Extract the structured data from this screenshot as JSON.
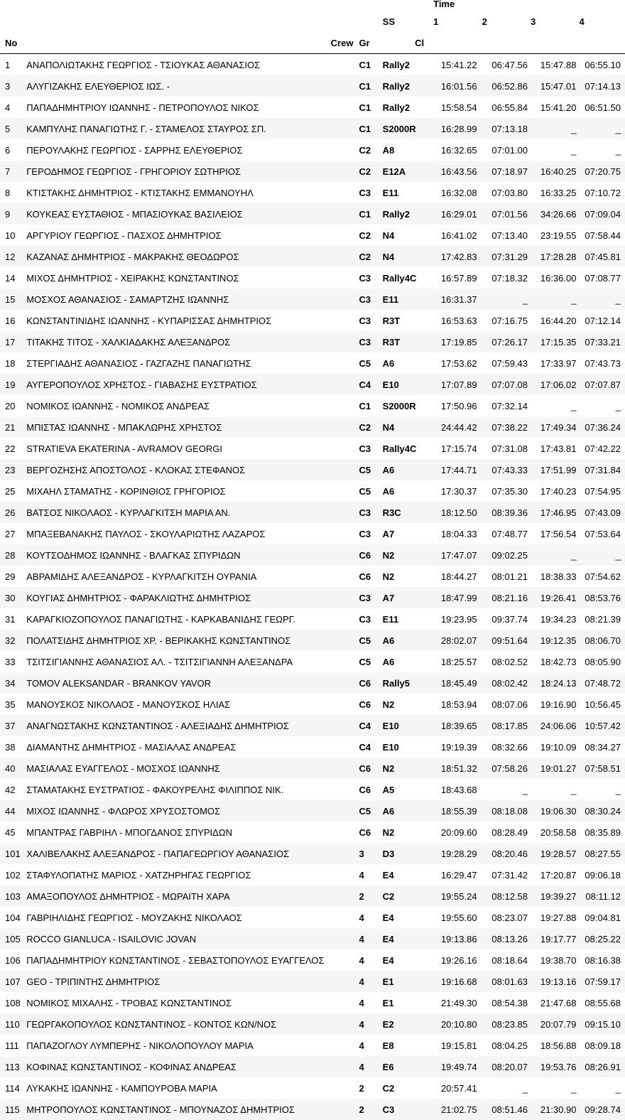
{
  "header": {
    "time_label": "Time",
    "ss_label": "SS",
    "stages": [
      "1",
      "2",
      "3",
      "4"
    ],
    "no_label": "No",
    "crew_label": "Crew",
    "gr_label": "Gr",
    "cl_label": "Cl"
  },
  "rows": [
    {
      "no": "1",
      "crew": "ΑΝΑΠΟΛΙΩΤΑΚΗΣ ΓΕΩΡΓΙΟΣ - ΤΣΙΟΥΚΑΣ ΑΘΑΝΑΣΙΟΣ",
      "gr": "C1",
      "cl": "Rally2",
      "t1": "15:41.22",
      "t2": "06:47.56",
      "t3": "15:47.88",
      "t4": "06:55.10"
    },
    {
      "no": "3",
      "crew": "ΑΛΥΓΙΖΑΚΗΣ ΕΛΕΥΘΕΡΙΟΣ ΙΩΣ. -",
      "gr": "C1",
      "cl": "Rally2",
      "t1": "16:01.56",
      "t2": "06:52.86",
      "t3": "15:47.01",
      "t4": "07:14.13"
    },
    {
      "no": "4",
      "crew": "ΠΑΠΑΔΗΜΗΤΡΙΟΥ ΙΩΑΝΝΗΣ - ΠΕΤΡΟΠΟΥΛΟΣ ΝΙΚΟΣ",
      "gr": "C1",
      "cl": "Rally2",
      "t1": "15:58.54",
      "t2": "06:55.84",
      "t3": "15:41.20",
      "t4": "06:51.50"
    },
    {
      "no": "5",
      "crew": "ΚΑΜΠΥΛΗΣ ΠΑΝΑΓΙΩΤΗΣ Γ. - ΣΤΑΜΕΛΟΣ ΣΤΑΥΡΟΣ ΣΠ.",
      "gr": "C1",
      "cl": "S2000R",
      "t1": "16:28.99",
      "t2": "07:13.18",
      "t3": "_",
      "t4": "_"
    },
    {
      "no": "6",
      "crew": "ΠΕΡΟΥΛΑΚΗΣ ΓΕΩΡΓΙΟΣ - ΣΑΡΡΗΣ ΕΛΕΥΘΕΡΙΟΣ",
      "gr": "C2",
      "cl": "A8",
      "t1": "16:32.65",
      "t2": "07:01.00",
      "t3": "_",
      "t4": "_"
    },
    {
      "no": "7",
      "crew": "ΓΕΡΟΔΗΜΟΣ ΓΕΩΡΓΙΟΣ - ΓΡΗΓΟΡΙΟΥ ΣΩΤΗΡΙΟΣ",
      "gr": "C2",
      "cl": "E12A",
      "t1": "16:43.56",
      "t2": "07:18.97",
      "t3": "16:40.25",
      "t4": "07:20.75"
    },
    {
      "no": "8",
      "crew": "ΚΤΙΣΤΑΚΗΣ ΔΗΜΗΤΡΙΟΣ - ΚΤΙΣΤΑΚΗΣ ΕΜΜΑΝΟΥΗΛ",
      "gr": "C3",
      "cl": "E11",
      "t1": "16:32.08",
      "t2": "07:03.80",
      "t3": "16:33.25",
      "t4": "07:10.72"
    },
    {
      "no": "9",
      "crew": "ΚΟΥΚΕΑΣ ΕΥΣΤΑΘΙΟΣ - ΜΠΑΣΙΟΥΚΑΣ ΒΑΣΙΛΕΙΟΣ",
      "gr": "C1",
      "cl": "Rally2",
      "t1": "16:29.01",
      "t2": "07:01.56",
      "t3": "34:26.66",
      "t4": "07:09.04"
    },
    {
      "no": "10",
      "crew": "ΑΡΓΥΡΙΟΥ ΓΕΩΡΓΙΟΣ - ΠΑΣΧΟΣ ΔΗΜΗΤΡΙΟΣ",
      "gr": "C2",
      "cl": "N4",
      "t1": "16:41.02",
      "t2": "07:13.40",
      "t3": "23:19.55",
      "t4": "07:58.44"
    },
    {
      "no": "12",
      "crew": "ΚΑΖΑΝΑΣ ΔΗΜΗΤΡΙΟΣ - ΜΑΚΡΑΚΗΣ ΘΕΟΔΩΡΟΣ",
      "gr": "C2",
      "cl": "N4",
      "t1": "17:42.83",
      "t2": "07:31.29",
      "t3": "17:28.28",
      "t4": "07:45.81"
    },
    {
      "no": "14",
      "crew": "ΜΙΧΟΣ ΔΗΜΗΤΡΙΟΣ - ΧΕΙΡΑΚΗΣ ΚΩΝΣΤΑΝΤΙΝΟΣ",
      "gr": "C3",
      "cl": "Rally4C",
      "t1": "16:57.89",
      "t2": "07:18.32",
      "t3": "16:36.00",
      "t4": "07:08.77"
    },
    {
      "no": "15",
      "crew": "ΜΟΣΧΟΣ ΑΘΑΝΑΣΙΟΣ - ΣΑΜΑΡΤΖΗΣ ΙΩΑΝΝΗΣ",
      "gr": "C3",
      "cl": "E11",
      "t1": "16:31.37",
      "t2": "_",
      "t3": "_",
      "t4": "_"
    },
    {
      "no": "16",
      "crew": "ΚΩΝΣΤΑΝΤΙΝΙΔΗΣ ΙΩΑΝΝΗΣ - ΚΥΠΑΡΙΣΣΑΣ ΔΗΜΗΤΡΙΟΣ",
      "gr": "C3",
      "cl": "R3T",
      "t1": "16:53.63",
      "t2": "07:16.75",
      "t3": "16:44.20",
      "t4": "07:12.14"
    },
    {
      "no": "17",
      "crew": "ΤΙΤΑΚΗΣ ΤΙΤΟΣ - ΧΑΛΚΙΑΔΑΚΗΣ ΑΛΕΞΑΝΔΡΟΣ",
      "gr": "C3",
      "cl": "R3T",
      "t1": "17:19.85",
      "t2": "07:26.17",
      "t3": "17:15.35",
      "t4": "07:33.21"
    },
    {
      "no": "18",
      "crew": "ΣΤΕΡΓΙΑΔΗΣ ΑΘΑΝΑΣΙΟΣ - ΓΑΖΓΑΖΗΣ ΠΑΝΑΓΙΩΤΗΣ",
      "gr": "C5",
      "cl": "A6",
      "t1": "17:53.62",
      "t2": "07:59.43",
      "t3": "17:33.97",
      "t4": "07:43.73"
    },
    {
      "no": "19",
      "crew": "ΑΥΓΕΡΟΠΟΥΛΟΣ ΧΡΗΣΤΟΣ - ΓΙΑΒΑΣΗΣ ΕΥΣΤΡΑΤΙΟΣ",
      "gr": "C4",
      "cl": "E10",
      "t1": "17:07.89",
      "t2": "07:07.08",
      "t3": "17:06.02",
      "t4": "07:07.87"
    },
    {
      "no": "20",
      "crew": "ΝΟΜΙΚΟΣ ΙΩΑΝΝΗΣ - ΝΟΜΙΚΟΣ ΑΝΔΡΕΑΣ",
      "gr": "C1",
      "cl": "S2000R",
      "t1": "17:50.96",
      "t2": "07:32.14",
      "t3": "_",
      "t4": "_"
    },
    {
      "no": "21",
      "crew": "ΜΠΙΣΤΑΣ ΙΩΑΝΝΗΣ - ΜΠΑΚΛΩΡΗΣ ΧΡΗΣΤΟΣ",
      "gr": "C2",
      "cl": "N4",
      "t1": "24:44.42",
      "t2": "07:38.22",
      "t3": "17:49.34",
      "t4": "07:36.24"
    },
    {
      "no": "22",
      "crew": "STRATIEVA EKATERINA - AVRAMOV GEORGI",
      "gr": "C3",
      "cl": "Rally4C",
      "t1": "17:15.74",
      "t2": "07:31.08",
      "t3": "17:43.81",
      "t4": "07:42.22"
    },
    {
      "no": "23",
      "crew": "ΒΕΡΓΟΖΗΣΗΣ ΑΠΟΣΤΟΛΟΣ - ΚΛΟΚΑΣ ΣΤΕΦΑΝΟΣ",
      "gr": "C5",
      "cl": "A6",
      "t1": "17:44.71",
      "t2": "07:43.33",
      "t3": "17:51.99",
      "t4": "07:31.84"
    },
    {
      "no": "25",
      "crew": "ΜΙΧΑΗΛ ΣΤΑΜΑΤΗΣ - ΚΟΡΙΝΘΙΟΣ ΓΡΗΓΟΡΙΟΣ",
      "gr": "C5",
      "cl": "A6",
      "t1": "17:30.37",
      "t2": "07:35.30",
      "t3": "17:40.23",
      "t4": "07:54.95"
    },
    {
      "no": "26",
      "crew": "ΒΑΤΣΟΣ ΝΙΚΟΛΑΟΣ - ΚΥΡΛΑΓΚΙΤΣΗ ΜΑΡΙΑ ΑΝ.",
      "gr": "C3",
      "cl": "R3C",
      "t1": "18:12.50",
      "t2": "08:39.36",
      "t3": "17:46.95",
      "t4": "07:43.09"
    },
    {
      "no": "27",
      "crew": "ΜΠΑΞΕΒΑΝΑΚΗΣ ΠΑΥΛΟΣ - ΣΚΟΥΛΑΡΙΩΤΗΣ ΛΑΖΑΡΟΣ",
      "gr": "C3",
      "cl": "A7",
      "t1": "18:04.33",
      "t2": "07:48.77",
      "t3": "17:56.54",
      "t4": "07:53.64"
    },
    {
      "no": "28",
      "crew": "ΚΟΥΤΣΟΔΗΜΟΣ ΙΩΑΝΝΗΣ - ΒΛΑΓΚΑΣ ΣΠΥΡΙΔΩΝ",
      "gr": "C6",
      "cl": "N2",
      "t1": "17:47.07",
      "t2": "09:02.25",
      "t3": "_",
      "t4": "_"
    },
    {
      "no": "29",
      "crew": "ΑΒΡΑΜΙΔΗΣ ΑΛΕΞΑΝΔΡΟΣ - ΚΥΡΛΑΓΚΙΤΣΗ ΟΥΡΑΝΙΑ",
      "gr": "C6",
      "cl": "N2",
      "t1": "18:44.27",
      "t2": "08:01.21",
      "t3": "18:38.33",
      "t4": "07:54.62"
    },
    {
      "no": "30",
      "crew": "ΚΟΥΓΙΑΣ ΔΗΜΗΤΡΙΟΣ - ΦΑΡΑΚΛΙΩΤΗΣ ΔΗΜΗΤΡΙΟΣ",
      "gr": "C3",
      "cl": "A7",
      "t1": "18:47.99",
      "t2": "08:21.16",
      "t3": "19:26.41",
      "t4": "08:53.76"
    },
    {
      "no": "31",
      "crew": "ΚΑΡΑΓΚΙΟΖΟΠΟΥΛΟΣ ΠΑΝΑΓΙΩΤΗΣ - ΚΑΡΚΑΒΑΝΙΔΗΣ ΓΕΩΡΓ.",
      "gr": "C3",
      "cl": "E11",
      "t1": "19:23.95",
      "t2": "09:37.74",
      "t3": "19:34.23",
      "t4": "08:21.39"
    },
    {
      "no": "32",
      "crew": "ΠΟΛΑΤΣΙΔΗΣ ΔΗΜΗΤΡΙΟΣ ΧΡ. - ΒΕΡΙΚΑΚΗΣ ΚΩΝΣΤΑΝΤΙΝΟΣ",
      "gr": "C5",
      "cl": "A6",
      "t1": "28:02.07",
      "t2": "09:51.64",
      "t3": "19:12.35",
      "t4": "08:06.70"
    },
    {
      "no": "33",
      "crew": "ΤΣΙΤΣΙΓΙΑΝΝΗΣ ΑΘΑΝΑΣΙΟΣ ΑΛ. - ΤΣΙΤΣΙΓΙΑΝΝΗ ΑΛΕΞΑΝΔΡΑ",
      "gr": "C5",
      "cl": "A6",
      "t1": "18:25.57",
      "t2": "08:02.52",
      "t3": "18:42.73",
      "t4": "08:05.90"
    },
    {
      "no": "34",
      "crew": "TOMOV ALEKSANDAR - BRANKOV YAVOR",
      "gr": "C6",
      "cl": "Rally5",
      "t1": "18:45.49",
      "t2": "08:02.42",
      "t3": "18:24.13",
      "t4": "07:48.72"
    },
    {
      "no": "35",
      "crew": "ΜΑΝΟΥΣΚΟΣ ΝΙΚΟΛΑΟΣ - ΜΑΝΟΥΣΚΟΣ ΗΛΙΑΣ",
      "gr": "C6",
      "cl": "N2",
      "t1": "18:53.94",
      "t2": "08:07.06",
      "t3": "19:16.90",
      "t4": "10:56.45"
    },
    {
      "no": "37",
      "crew": "ΑΝΑΓΝΩΣΤΑΚΗΣ ΚΩΝΣΤΑΝΤΙΝΟΣ - ΑΛΕΞΙΑΔΗΣ ΔΗΜΗΤΡΙΟΣ",
      "gr": "C4",
      "cl": "E10",
      "t1": "18:39.65",
      "t2": "08:17.85",
      "t3": "24:06.06",
      "t4": "10:57.42"
    },
    {
      "no": "38",
      "crew": "ΔΙΑΜΑΝΤΗΣ ΔΗΜΗΤΡΙΟΣ - ΜΑΣΙΑΛΑΣ ΑΝΔΡΕΑΣ",
      "gr": "C4",
      "cl": "E10",
      "t1": "19:19.39",
      "t2": "08:32.66",
      "t3": "19:10.09",
      "t4": "08:34.27"
    },
    {
      "no": "40",
      "crew": "ΜΑΣΙΑΛΑΣ ΕΥΑΓΓΕΛΟΣ - ΜΟΣΧΟΣ ΙΩΑΝΝΗΣ",
      "gr": "C6",
      "cl": "N2",
      "t1": "18:51.32",
      "t2": "07:58.26",
      "t3": "19:01.27",
      "t4": "07:58.51"
    },
    {
      "no": "42",
      "crew": "ΣΤΑΜΑΤΑΚΗΣ ΕΥΣΤΡΑΤΙΟΣ - ΦΑΚΟΥΡΕΛΗΣ ΦΙΛΙΠΠΟΣ ΝΙΚ.",
      "gr": "C6",
      "cl": "A5",
      "t1": "18:43.68",
      "t2": "_",
      "t3": "_",
      "t4": "_"
    },
    {
      "no": "44",
      "crew": "ΜΙΧΟΣ ΙΩΑΝΝΗΣ - ΦΛΩΡΟΣ ΧΡΥΣΟΣΤΟΜΟΣ",
      "gr": "C5",
      "cl": "A6",
      "t1": "18:55.39",
      "t2": "08:18.08",
      "t3": "19:06.30",
      "t4": "08:30.24"
    },
    {
      "no": "45",
      "crew": "ΜΠΑΝΤΡΑΣ ΓΑΒΡΙΗΛ - ΜΠΟΓΔΑΝΟΣ ΣΠΥΡΙΔΩΝ",
      "gr": "C6",
      "cl": "N2",
      "t1": "20:09.60",
      "t2": "08:28.49",
      "t3": "20:58.58",
      "t4": "08:35.89"
    },
    {
      "no": "101",
      "crew": "ΧΑΛΙΒΕΛΑΚΗΣ ΑΛΕΞΑΝΔΡΟΣ - ΠΑΠΑΓΕΩΡΓΙΟΥ ΑΘΑΝΑΣΙΟΣ",
      "gr": "3",
      "cl": "D3",
      "t1": "19:28.29",
      "t2": "08:20.46",
      "t3": "19:28.57",
      "t4": "08:27.55"
    },
    {
      "no": "102",
      "crew": "ΣΤΑΦΥΛΟΠΑΤΗΣ ΜΑΡΙΟΣ - ΧΑΤΖΗΡΗΓΑΣ ΓΕΩΡΓΙΟΣ",
      "gr": "4",
      "cl": "E4",
      "t1": "16:29.47",
      "t2": "07:31.42",
      "t3": "17:20.87",
      "t4": "09:06.18"
    },
    {
      "no": "103",
      "crew": "ΑΜΑΞΟΠΟΥΛΟΣ ΔΗΜΗΤΡΙΟΣ - ΜΩΡΑΙΤΗ ΧΑΡΑ",
      "gr": "2",
      "cl": "C2",
      "t1": "19:55.24",
      "t2": "08:12.58",
      "t3": "19:39.27",
      "t4": "08:11.12"
    },
    {
      "no": "104",
      "crew": "ΓΑΒΡΙΗΛΙΔΗΣ ΓΕΩΡΓΙΟΣ - ΜΟΥΖΑΚΗΣ ΝΙΚΟΛΑΟΣ",
      "gr": "4",
      "cl": "E4",
      "t1": "19:55.60",
      "t2": "08:23.07",
      "t3": "19:27.88",
      "t4": "09:04.81"
    },
    {
      "no": "105",
      "crew": "ROCCO GIANLUCA - ISAILOVIC JOVAN",
      "gr": "4",
      "cl": "E4",
      "t1": "19:13.86",
      "t2": "08:13.26",
      "t3": "19:17.77",
      "t4": "08:25.22"
    },
    {
      "no": "106",
      "crew": "ΠΑΠΑΔΗΜΗΤΡΙΟΥ ΚΩΝΣΤΑΝΤΙΝΟΣ - ΣΕΒΑΣΤΟΠΟΥΛΟΣ ΕΥΑΓΓΕΛΟΣ",
      "gr": "4",
      "cl": "E4",
      "t1": "19:26.16",
      "t2": "08:18.64",
      "t3": "19:38.70",
      "t4": "08:16.38"
    },
    {
      "no": "107",
      "crew": "GEO - ΤΡΙΠΙΝΤΗΣ ΔΗΜΗΤΡΙΟΣ",
      "gr": "4",
      "cl": "E1",
      "t1": "19:16.68",
      "t2": "08:01.63",
      "t3": "19:13.16",
      "t4": "07:59.17"
    },
    {
      "no": "108",
      "crew": "ΝΟΜΙΚΟΣ ΜΙΧΑΛΗΣ - ΤΡΟΒΑΣ ΚΩΝΣΤΑΝΤΙΝΟΣ",
      "gr": "4",
      "cl": "E1",
      "t1": "21:49.30",
      "t2": "08:54.38",
      "t3": "21:47.68",
      "t4": "08:55.68"
    },
    {
      "no": "110",
      "crew": "ΓΕΩΡΓΑΚΟΠΟΥΛΟΣ ΚΩΝΣΤΑΝΤΙΝΟΣ - ΚΟΝΤΟΣ ΚΩΝ/ΝΟΣ",
      "gr": "4",
      "cl": "E2",
      "t1": "20:10.80",
      "t2": "08:23.85",
      "t3": "20:07.79",
      "t4": "09:15.10"
    },
    {
      "no": "111",
      "crew": "ΠΑΠΑΖΟΓΛΟΥ ΛΥΜΠΕΡΗΣ - ΝΙΚΟΛΟΠΟΥΛΟΥ ΜΑΡΙΑ",
      "gr": "4",
      "cl": "E8",
      "t1": "19:15.81",
      "t2": "08:04.25",
      "t3": "18:56.88",
      "t4": "08:09.18"
    },
    {
      "no": "113",
      "crew": "ΚΟΦΙΝΑΣ ΚΩΝΣΤΑΝΤΙΝΟΣ - ΚΟΦΙΝΑΣ ΑΝΔΡΕΑΣ",
      "gr": "4",
      "cl": "E6",
      "t1": "19:49.74",
      "t2": "08:20.07",
      "t3": "19:53.76",
      "t4": "08:26.91"
    },
    {
      "no": "114",
      "crew": "ΛΥΚΑΚΗΣ ΙΩΑΝΝΗΣ - ΚΑΜΠΟΥΡΟΒΑ ΜΑΡΙΑ",
      "gr": "2",
      "cl": "C2",
      "t1": "20:57.41",
      "t2": "_",
      "t3": "_",
      "t4": "_"
    },
    {
      "no": "115",
      "crew": "ΜΗΤΡΟΠΟΥΛΟΣ ΚΩΝΣΤΑΝΤΙΝΟΣ - ΜΠΟΥΝΑΖΟΣ ΔΗΜΗΤΡΙΟΣ",
      "gr": "2",
      "cl": "C3",
      "t1": "21:02.75",
      "t2": "08:51.46",
      "t3": "21:30.90",
      "t4": "09:28.74"
    }
  ]
}
